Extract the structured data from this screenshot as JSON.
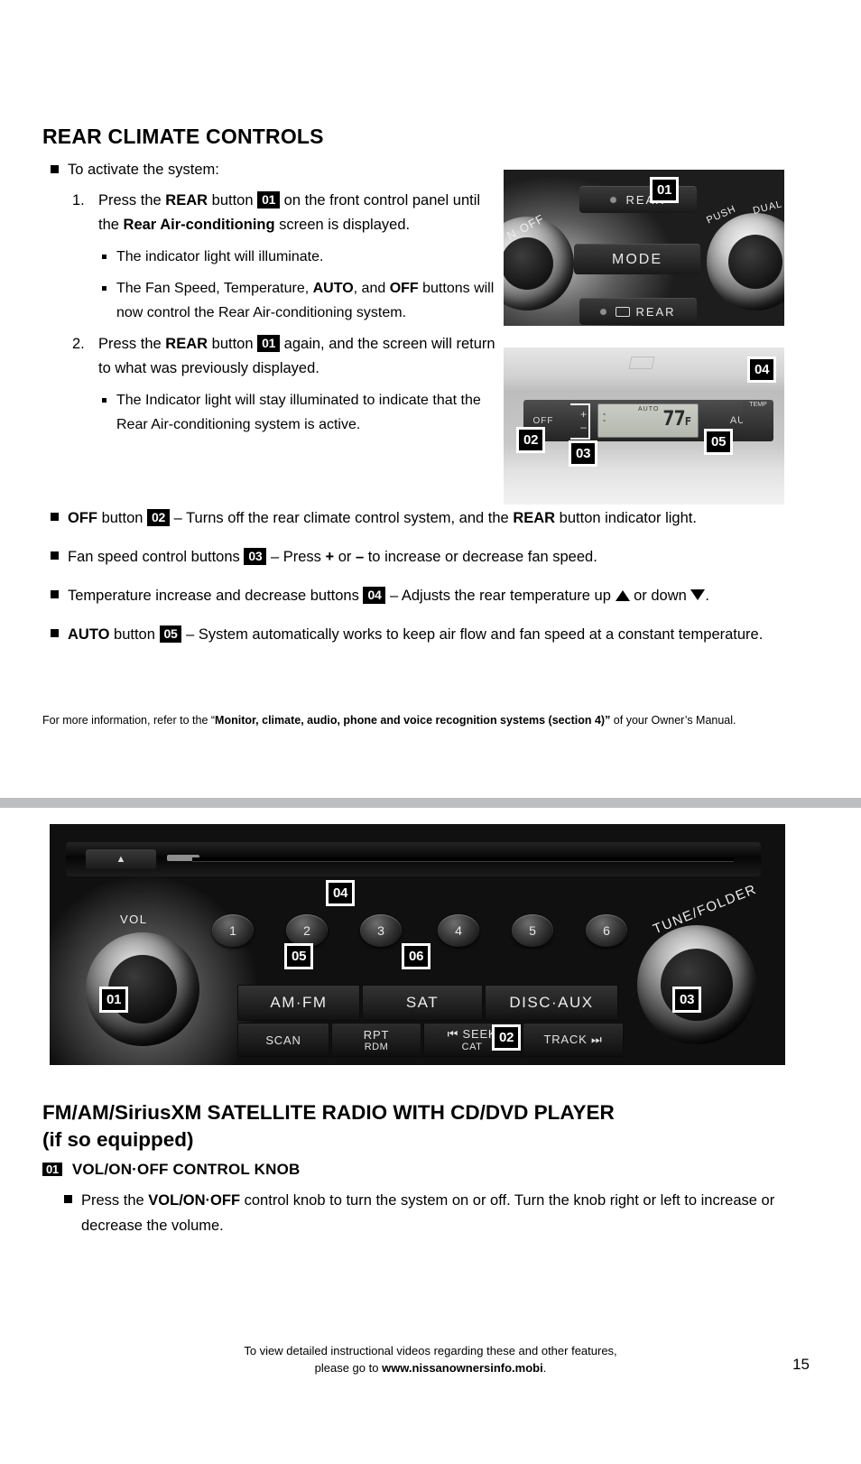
{
  "section": {
    "title": "REAR CLIMATE CONTROLS",
    "activate_intro": "To activate the system:",
    "steps": [
      {
        "number": "1.",
        "pre": "Press the ",
        "bold1": "REAR",
        "mid1": " button ",
        "chip": "01",
        "post1": " on the front control panel until the ",
        "bold2": "Rear Air-conditioning",
        "post2": " screen is displayed.",
        "subs": [
          {
            "text": "The indicator light will illuminate."
          },
          {
            "pre": "The Fan Speed, Temperature, ",
            "bold1": "AUTO",
            "mid": ", and ",
            "bold2": "OFF",
            "post": " buttons will now control the Rear Air-conditioning system."
          }
        ]
      },
      {
        "number": "2.",
        "pre": "Press the ",
        "bold1": "REAR",
        "mid1": " button ",
        "chip": "01",
        "post1": " again, and the screen will return to what was previously displayed.",
        "subs": [
          {
            "text": "The Indicator light will stay illuminated to indicate that the Rear Air-conditioning system is active."
          }
        ]
      }
    ],
    "features": [
      {
        "bold_lead": "OFF",
        "lead_rest": " button ",
        "chip": "02",
        "mid": " – Turns off the rear climate control system, and the ",
        "bold_tail": "REAR",
        "tail_rest": " button indicator light."
      },
      {
        "bold_lead": "",
        "lead_rest": "Fan speed control buttons ",
        "chip": "03",
        "mid": " – Press ",
        "plus": "+",
        "or": " or ",
        "minus": "–",
        "tail_rest": " to increase or decrease fan speed."
      },
      {
        "bold_lead": "",
        "lead_rest": "Temperature increase and decrease buttons ",
        "chip": "04",
        "mid": " – Adjusts the rear temperature up ",
        "tail_rest": " or down ",
        "period": "."
      },
      {
        "bold_lead": "AUTO",
        "lead_rest": " button ",
        "chip": "05",
        "mid": " – System automatically works to keep air flow and fan speed at a constant temperature."
      }
    ],
    "footnote": {
      "pre": "For more information, refer to the “",
      "bold": "Monitor, climate, audio, phone and voice recognition systems (section 4)”",
      "post": " of your Owner’s Manual."
    }
  },
  "photo_climate_front": {
    "caption_chip": "01",
    "btn_rear_top": "REAR",
    "btn_mode": "MODE",
    "btn_rear_bottom": "REAR",
    "label_onoff": "N·OFF",
    "label_push": "PUSH",
    "label_dual": "DUAL"
  },
  "photo_climate_rear": {
    "chips": [
      "02",
      "03",
      "04",
      "05"
    ],
    "label_off": "OFF",
    "label_fan_plus": "+",
    "label_fan_minus": "–",
    "label_auto": "AUTO",
    "label_temp": "TEMP",
    "lcd_value": "77",
    "lcd_unit": "F",
    "lcd_auto": "AUTO",
    "lcd_mini_1": "≈",
    "lcd_mini_2": "≈"
  },
  "photo_radio": {
    "chips": [
      "01",
      "02",
      "03",
      "04",
      "05",
      "06"
    ],
    "presets": [
      "1",
      "2",
      "3",
      "4",
      "5",
      "6"
    ],
    "source_buttons": [
      "AM·FM",
      "SAT",
      "DISC·AUX"
    ],
    "function_buttons": [
      {
        "main": "SCAN",
        "sub": ""
      },
      {
        "main": "RPT",
        "sub": "RDM"
      },
      {
        "main": "⏮ SEEK",
        "sub": "CAT"
      },
      {
        "main": "TRACK ⏭",
        "sub": ""
      }
    ],
    "knob_vol_label": "VOL",
    "knob_tune_label": "TUNE/FOLDER",
    "eject_label": "▲"
  },
  "article": {
    "title_line1": "FM/AM/SiriusXM SATELLITE RADIO WITH CD/DVD PLAYER",
    "title_line2": "(if so equipped)",
    "sub_chip": "01",
    "sub_head": "VOL/ON·OFF CONTROL KNOB",
    "bullet": {
      "pre": "Press the ",
      "bold": "VOL/ON·OFF",
      "post": " control knob to turn the system on or off. Turn the knob right or left to increase or decrease the volume."
    }
  },
  "footer": {
    "line1": "To view detailed instructional videos regarding these and other features,",
    "line2_pre": "please go to ",
    "line2_bold": "www.nissanownersinfo.mobi",
    "line2_post": ".",
    "page_number": "15"
  },
  "colors": {
    "divider": "#bcbec0",
    "chip_bg": "#000000",
    "chip_fg": "#ffffff",
    "text": "#000000",
    "page_bg": "#ffffff"
  }
}
